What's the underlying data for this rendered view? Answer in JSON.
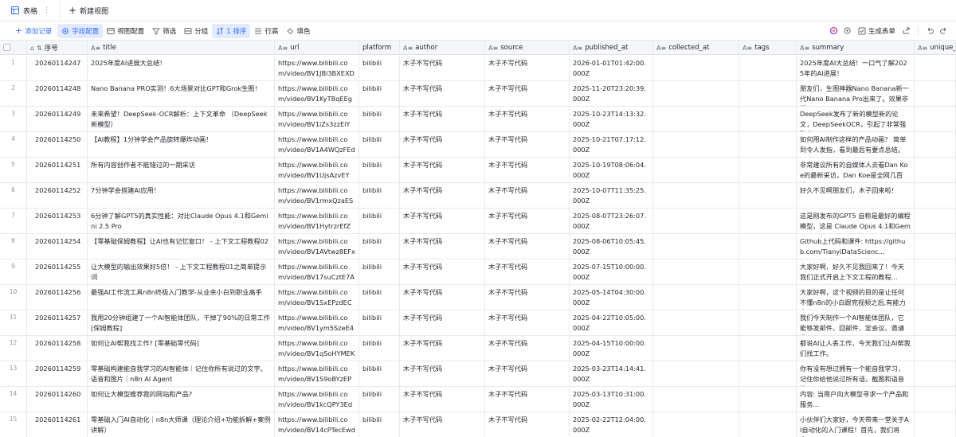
{
  "tabs": [
    {
      "label": "表格"
    }
  ],
  "new_view_label": "新建视图",
  "toolbar": {
    "add_record": "添加记录",
    "field_config": "字段配置",
    "view_config": "视图配置",
    "filter": "筛选",
    "group": "分组",
    "sort": "1 排序",
    "row_height": "行高",
    "fill_color": "填色",
    "generate_form": "生成表单"
  },
  "columns": [
    {
      "label": "序号",
      "type_icon": "sort-icon"
    },
    {
      "label": "title",
      "type_icon": "text-field-icon"
    },
    {
      "label": "url",
      "type_icon": "text-field-icon"
    },
    {
      "label": "platform",
      "type_icon": ""
    },
    {
      "label": "author",
      "type_icon": "text-field-icon"
    },
    {
      "label": "source",
      "type_icon": "text-field-icon"
    },
    {
      "label": "published_at",
      "type_icon": "text-field-icon"
    },
    {
      "label": "collected_at",
      "type_icon": "text-field-icon"
    },
    {
      "label": "tags",
      "type_icon": "text-field-icon"
    },
    {
      "label": "summary",
      "type_icon": "text-field-icon"
    },
    {
      "label": "unique_k",
      "type_icon": "text-field-icon"
    }
  ],
  "rows": [
    {
      "n": "1",
      "seq": "20260114247",
      "title": "2025年度AI进展大总结！",
      "url": "https://www.bilibili.com/video/BV1JBi3BXEXD",
      "platform": "bilibili",
      "author": "木子不写代码",
      "source": "木子不写代码",
      "published_at": "2026-01-01T01:42:00.000Z",
      "collected_at": "",
      "tags": "",
      "summary": "2025年度AI大总结！一口气了解2025年的AI进展！",
      "unique": ""
    },
    {
      "n": "2",
      "seq": "20260114248",
      "title": "Nano Banana PRO实测！6大场景对比GPT和Grok生图！",
      "url": "https://www.bilibili.com/video/BV1KyTBqEEg",
      "platform": "bilibili",
      "author": "木子不写代码",
      "source": "木子不写代码",
      "published_at": "2025-11-20T23:20:39.000Z",
      "collected_at": "",
      "tags": "",
      "summary": "朋友们，生图神器Nano Banana新一代Nano Banana Pro出来了。效果非常...",
      "unique": ""
    },
    {
      "n": "3",
      "seq": "20260114249",
      "title": "未来希望！DeepSeek-OCR解析：上下文革命 （DeepSeek新模型）",
      "url": "https://www.bilibili.com/video/BV1iZs3zzEiY",
      "platform": "bilibili",
      "author": "木子不写代码",
      "source": "木子不写代码",
      "published_at": "2025-10-23T14:13:32.000Z",
      "collected_at": "",
      "tags": "",
      "summary": "DeepSeek发布了新的模型新的论文，DeepSeekOCR，引起了非常强烈的...",
      "unique": ""
    },
    {
      "n": "4",
      "seq": "20260114250",
      "title": "【AI教程】1分钟学会产品旋转爆炸动画！",
      "url": "https://www.bilibili.com/video/BV1A4WQzFEdH",
      "platform": "bilibili",
      "author": "木子不写代码",
      "source": "木子不写代码",
      "published_at": "2025-10-21T07:17:12.000Z",
      "collected_at": "",
      "tags": "",
      "summary": "如何用AI制作这样的产品动画？ 简单到令人发指，看到最后有要点总结。",
      "unique": ""
    },
    {
      "n": "5",
      "seq": "20260114251",
      "title": "所有内容创作者不能错过的一期采访",
      "url": "https://www.bilibili.com/video/BV1UjsAzvEYW",
      "platform": "bilibili",
      "author": "木子不写代码",
      "source": "木子不写代码",
      "published_at": "2025-10-19T08:06:04.000Z",
      "collected_at": "",
      "tags": "",
      "summary": "非常建议所有的自媒体人去看Dan Koe的最新采访，Dan Koe是全网几百万...",
      "unique": ""
    },
    {
      "n": "6",
      "seq": "20260114252",
      "title": "7分钟学会搭建AI应用！",
      "url": "https://www.bilibili.com/video/BV1rmxQzaESq",
      "platform": "bilibili",
      "author": "木子不写代码",
      "source": "木子不写代码",
      "published_at": "2025-10-07T11:35:25.000Z",
      "collected_at": "",
      "tags": "",
      "summary": "好久不见啊朋友们，木子回来啦！",
      "unique": ""
    },
    {
      "n": "7",
      "seq": "20260114253",
      "title": "6分钟了解GPT5的真实性能：对比Claude Opus 4.1和Gemini 2.5 Pro",
      "url": "https://www.bilibili.com/video/BV1HytrzrEfZ",
      "platform": "bilibili",
      "author": "木子不写代码",
      "source": "木子不写代码",
      "published_at": "2025-08-07T23:26:07.000Z",
      "collected_at": "",
      "tags": "",
      "summary": "这是刚发布的GPT5 自称是最好的编程模型，这是 Claude Opus 4.1和Gemin...",
      "unique": ""
    },
    {
      "n": "8",
      "seq": "20260114254",
      "title": "【零基础保姆教程】让AI也有记忆窗口！ - 上下文工程教程02",
      "url": "https://www.bilibili.com/video/BV1AVtwz8EFx",
      "platform": "bilibili",
      "author": "木子不写代码",
      "source": "木子不写代码",
      "published_at": "2025-08-06T10:05:45.000Z",
      "collected_at": "",
      "tags": "",
      "summary": "Github上代码和课件: https://github.com/TianyiDataScienc...",
      "unique": ""
    },
    {
      "n": "9",
      "seq": "20260114255",
      "title": "让大模型的输出效果好5倍！ - 上下文工程教程01之简单提示词",
      "url": "https://www.bilibili.com/video/BV17suCztE7A",
      "platform": "bilibili",
      "author": "木子不写代码",
      "source": "木子不写代码",
      "published_at": "2025-07-15T10:00:00.000Z",
      "collected_at": "",
      "tags": "",
      "summary": "大家好啊，好久不见我回来了！今天我们正式开启上下文工程的教程...",
      "unique": ""
    },
    {
      "n": "10",
      "seq": "20260114256",
      "title": "最强AI工作流工具n8n终极入门教学-从业余小白到职业高手",
      "url": "https://www.bilibili.com/video/BV1SxEPzdECk",
      "platform": "bilibili",
      "author": "木子不写代码",
      "source": "木子不写代码",
      "published_at": "2025-05-14T04:30:00.000Z",
      "collected_at": "",
      "tags": "",
      "summary": "大家好啊，这个视频的目的是让任何不懂n8n的小白跟完视频之后,有能力实...",
      "unique": ""
    },
    {
      "n": "11",
      "seq": "20260114257",
      "title": "我用20分钟组建了一个AI智能体团队，干掉了90%的日常工作[保姆教程]",
      "url": "https://www.bilibili.com/video/BV1ym5SzeE4J",
      "platform": "bilibili",
      "author": "木子不写代码",
      "source": "木子不写代码",
      "published_at": "2025-04-22T10:05:00.000Z",
      "collected_at": "",
      "tags": "",
      "summary": "我们今天制作一个AI智能体团队，它能够发邮件、回邮件、定会议、邀请参...",
      "unique": ""
    },
    {
      "n": "12",
      "seq": "20260114258",
      "title": "如何让AI帮我找工作? [零基础零代码]",
      "url": "https://www.bilibili.com/video/BV1qSoHYMEKi",
      "platform": "bilibili",
      "author": "木子不写代码",
      "source": "木子不写代码",
      "published_at": "2025-04-15T10:00:00.000Z",
      "collected_at": "",
      "tags": "",
      "summary": "都说AI让人丢工作，今天我们让AI帮我们找工作。",
      "unique": ""
    },
    {
      "n": "13",
      "seq": "20260114259",
      "title": "零基础构建能自我学习的AI智能体｜记住你所有说过的文字、语音和图片｜n8n AI Agent",
      "url": "https://www.bilibili.com/video/BV1S9oBYzEPW",
      "platform": "bilibili",
      "author": "木子不写代码",
      "source": "木子不写代码",
      "published_at": "2025-03-23T14:14:41.000Z",
      "collected_at": "",
      "tags": "",
      "summary": "你有没有想过拥有一个能自我学习，记住你给他说过所有话，截图和语音的...",
      "unique": ""
    },
    {
      "n": "14",
      "seq": "20260114260",
      "title": "如何让大模型推荐我的网站和产品?",
      "url": "https://www.bilibili.com/video/BV1kcQPY3EdP",
      "platform": "bilibili",
      "author": "木子不写代码",
      "source": "木子不写代码",
      "published_at": "2025-03-13T10:31:00.000Z",
      "collected_at": "",
      "tags": "",
      "summary": "内容: 当用户向大模型寻求一个产品和服务...",
      "unique": ""
    },
    {
      "n": "15",
      "seq": "20260114261",
      "title": "零基础入门AI自动化｜n8n大师课（理论介绍+功能拆解+案例讲解）",
      "url": "https://www.bilibili.com/video/BV14cPTecEwd",
      "platform": "bilibili",
      "author": "木子不写代码",
      "source": "木子不写代码",
      "published_at": "2025-02-22T12:04:00.000Z",
      "collected_at": "",
      "tags": "",
      "summary": "小伙伴们大家好，今天带来一堂关于AI自动化的入门课程！首先，我们将介...",
      "unique": ""
    }
  ]
}
